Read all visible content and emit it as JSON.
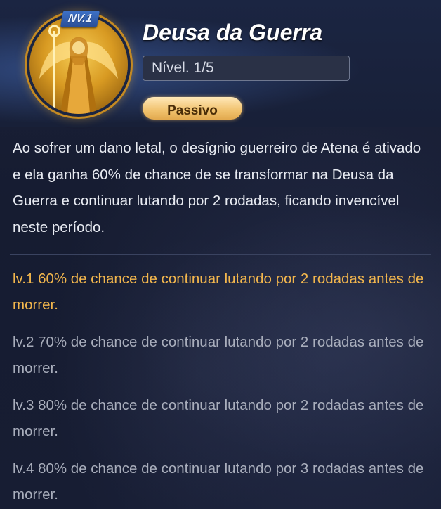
{
  "skill": {
    "badge": "NV.1",
    "name": "Deusa da Guerra",
    "level_text": "Nível. 1/5",
    "type_label": "Passivo",
    "portrait_icon": "goddess-portrait-icon",
    "description": "Ao sofrer um dano letal, o desígnio guerreiro de Atena é ativado e ela ganha 60% de chance de se transformar na Deusa da Guerra e continuar lutando por 2 rodadas, ficando invencível neste período."
  },
  "levels": [
    {
      "text": "lv.1 60% de chance de continuar lutando por 2 rodadas antes de morrer.",
      "active": true
    },
    {
      "text": "lv.2 70% de chance de continuar lutando por 2 rodadas antes de morrer.",
      "active": false
    },
    {
      "text": "lv.3 80% de chance de continuar lutando por 2 rodadas antes de morrer.",
      "active": false
    },
    {
      "text": "lv.4 80% de chance de continuar lutando por 3 rodadas antes de morrer.",
      "active": false
    }
  ],
  "colors": {
    "active_level": "#f2b64d",
    "inactive_level": "#a9aebc",
    "title": "#ffffff",
    "background": "#171d33"
  }
}
